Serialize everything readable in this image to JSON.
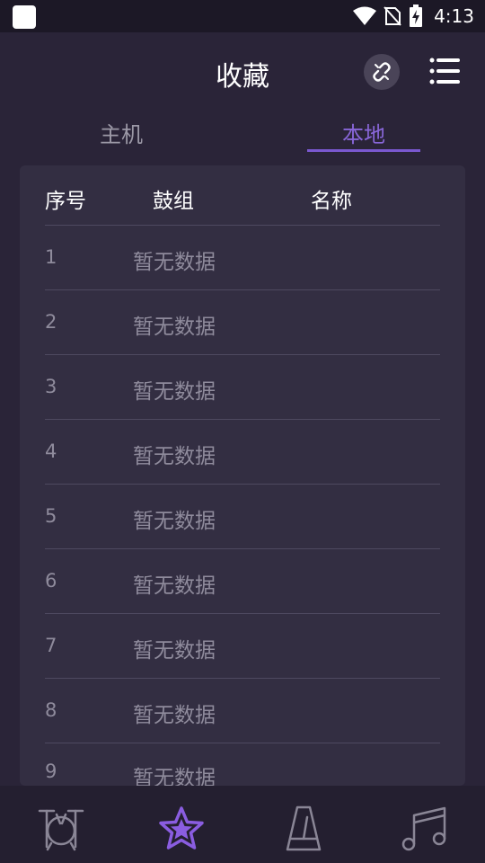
{
  "status_bar": {
    "time": "4:13",
    "icons": [
      "app-icon",
      "wifi-icon",
      "no-sim-icon",
      "battery-charging-icon"
    ]
  },
  "header": {
    "title": "收藏",
    "link_icon": "link-off-icon",
    "menu_icon": "menu-icon"
  },
  "tabs": [
    {
      "label": "主机",
      "active": false
    },
    {
      "label": "本地",
      "active": true
    }
  ],
  "table": {
    "columns": [
      "序号",
      "鼓组",
      "名称"
    ],
    "rows": [
      {
        "index": "1",
        "kit": "暂无数据"
      },
      {
        "index": "2",
        "kit": "暂无数据"
      },
      {
        "index": "3",
        "kit": "暂无数据"
      },
      {
        "index": "4",
        "kit": "暂无数据"
      },
      {
        "index": "5",
        "kit": "暂无数据"
      },
      {
        "index": "6",
        "kit": "暂无数据"
      },
      {
        "index": "7",
        "kit": "暂无数据"
      },
      {
        "index": "8",
        "kit": "暂无数据"
      },
      {
        "index": "9",
        "kit": "暂无数据"
      }
    ]
  },
  "bottom_nav": [
    {
      "icon": "drum-icon",
      "active": false
    },
    {
      "icon": "star-icon",
      "active": true
    },
    {
      "icon": "metronome-icon",
      "active": false
    },
    {
      "icon": "music-note-icon",
      "active": false
    }
  ],
  "colors": {
    "background": "#2a2438",
    "card": "#332e42",
    "accent": "#7a58d0",
    "muted_text": "#8f8b9c"
  }
}
